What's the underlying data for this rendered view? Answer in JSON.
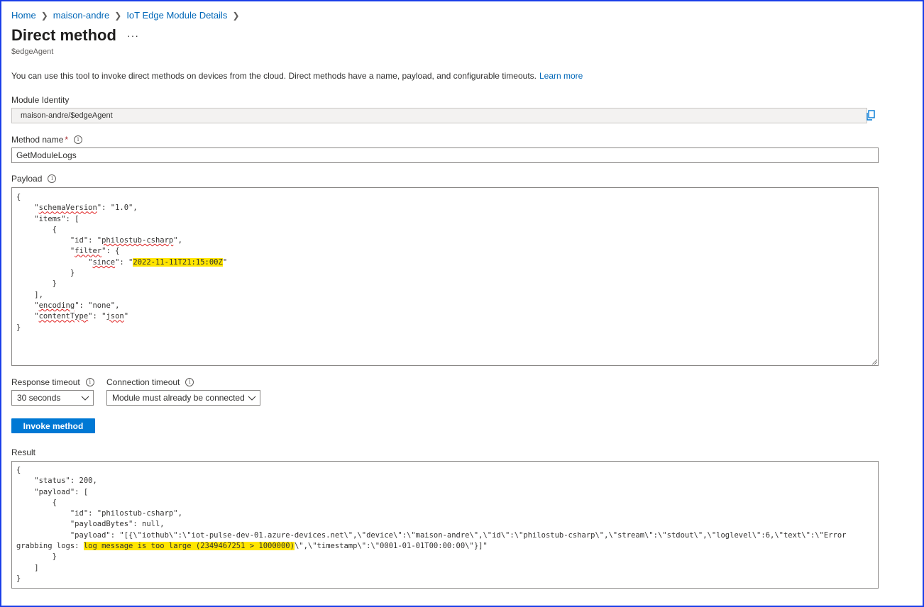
{
  "breadcrumb": [
    "Home",
    "maison-andre",
    "IoT Edge Module Details"
  ],
  "page": {
    "title": "Direct method",
    "more_label": "···",
    "subtitle": "$edgeAgent",
    "description": "You can use this tool to invoke direct methods on devices from the cloud. Direct methods have a name, payload, and configurable timeouts.",
    "learn_more": "Learn more"
  },
  "module_identity": {
    "label": "Module Identity",
    "value": "maison-andre/$edgeAgent"
  },
  "method_name": {
    "label": "Method name",
    "required_mark": "*",
    "value": "GetModuleLogs"
  },
  "payload": {
    "label": "Payload",
    "lines": [
      "{",
      "    \"schemaVersion\": \"1.0\",",
      "    \"items\": [",
      "        {",
      "            \"id\": \"philostub-csharp\",",
      "            \"filter\": {",
      "                \"since\": \"2022-11-11T21:15:00Z\"",
      "            }",
      "        }",
      "    ],",
      "    \"encoding\": \"none\",",
      "    \"contentType\": \"json\"",
      "}"
    ]
  },
  "response_timeout": {
    "label": "Response timeout",
    "value": "30 seconds"
  },
  "connection_timeout": {
    "label": "Connection timeout",
    "value": "Module must already be connected"
  },
  "invoke_button": "Invoke method",
  "result": {
    "label": "Result",
    "lines": [
      "{",
      "    \"status\": 200,",
      "    \"payload\": [",
      "        {",
      "            \"id\": \"philostub-csharp\",",
      "            \"payloadBytes\": null,",
      "            \"payload\": \"[{\\\"iothub\\\":\\\"iot-pulse-dev-01.azure-devices.net\\\",\\\"device\\\":\\\"maison-andre\\\",\\\"id\\\":\\\"philostub-csharp\\\",\\\"stream\\\":\\\"stdout\\\",\\\"loglevel\\\":6,\\\"text\\\":\\\"Error",
      "grabbing logs: log message is too large (2349467251 > 1000000)\\\",\\\"timestamp\\\":\\\"0001-01-01T00:00:00\\\"}]\"",
      "        }",
      "    ]",
      "}"
    ]
  },
  "colors": {
    "link": "#0067b8",
    "primary_button": "#0078d4",
    "highlight": "#ffe500",
    "frame_border": "#1a3ee8"
  }
}
